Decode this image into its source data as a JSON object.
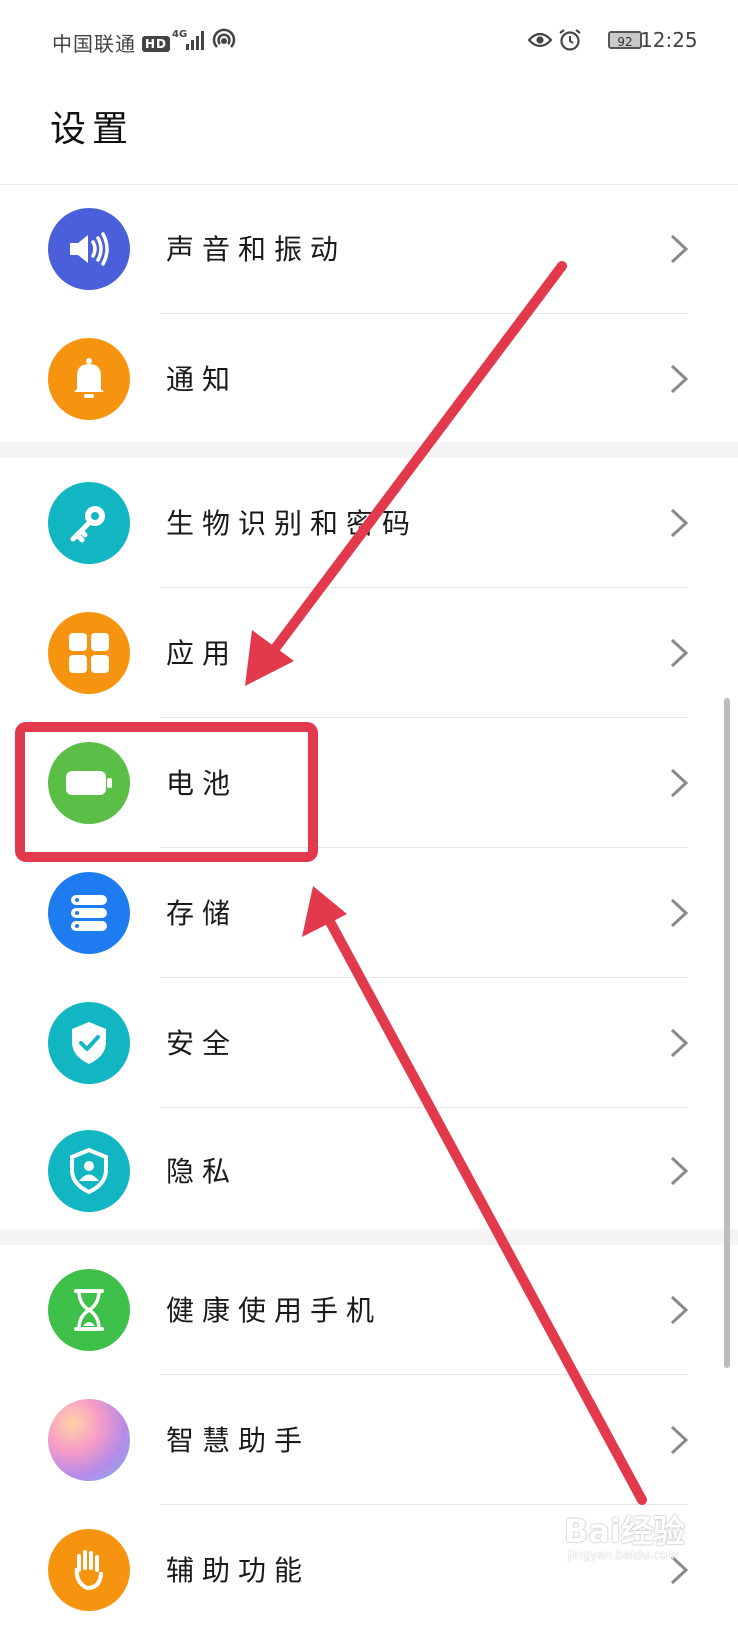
{
  "status_bar": {
    "carrier": "中国联通",
    "hd": "HD",
    "network": "4G",
    "battery": "92",
    "time": "12:25"
  },
  "title": "设置",
  "items": [
    {
      "label": "声音和振动",
      "icon": "speaker-icon",
      "color": "#4a5fd9"
    },
    {
      "label": "通知",
      "icon": "bell-icon",
      "color": "#f7940f"
    },
    {
      "label": "生物识别和密码",
      "icon": "key-icon",
      "color": "#12b6c3"
    },
    {
      "label": "应用",
      "icon": "apps-grid-icon",
      "color": "#f7940f"
    },
    {
      "label": "电池",
      "icon": "battery-icon",
      "color": "#5bbf47"
    },
    {
      "label": "存储",
      "icon": "storage-icon",
      "color": "#1f7cf0"
    },
    {
      "label": "安全",
      "icon": "shield-check-icon",
      "color": "#12b6c3"
    },
    {
      "label": "隐私",
      "icon": "privacy-shield-icon",
      "color": "#12b6c3"
    },
    {
      "label": "健康使用手机",
      "icon": "hourglass-icon",
      "color": "#3fc04a"
    },
    {
      "label": "智慧助手",
      "icon": "smart-assistant-icon",
      "color": "#c58be0"
    },
    {
      "label": "辅助功能",
      "icon": "hand-icon",
      "color": "#f7940f"
    }
  ],
  "annotation": {
    "color": "#e23a4c"
  },
  "watermark": {
    "brand": "Bai经验",
    "site": "jingyan.baidu.com"
  }
}
